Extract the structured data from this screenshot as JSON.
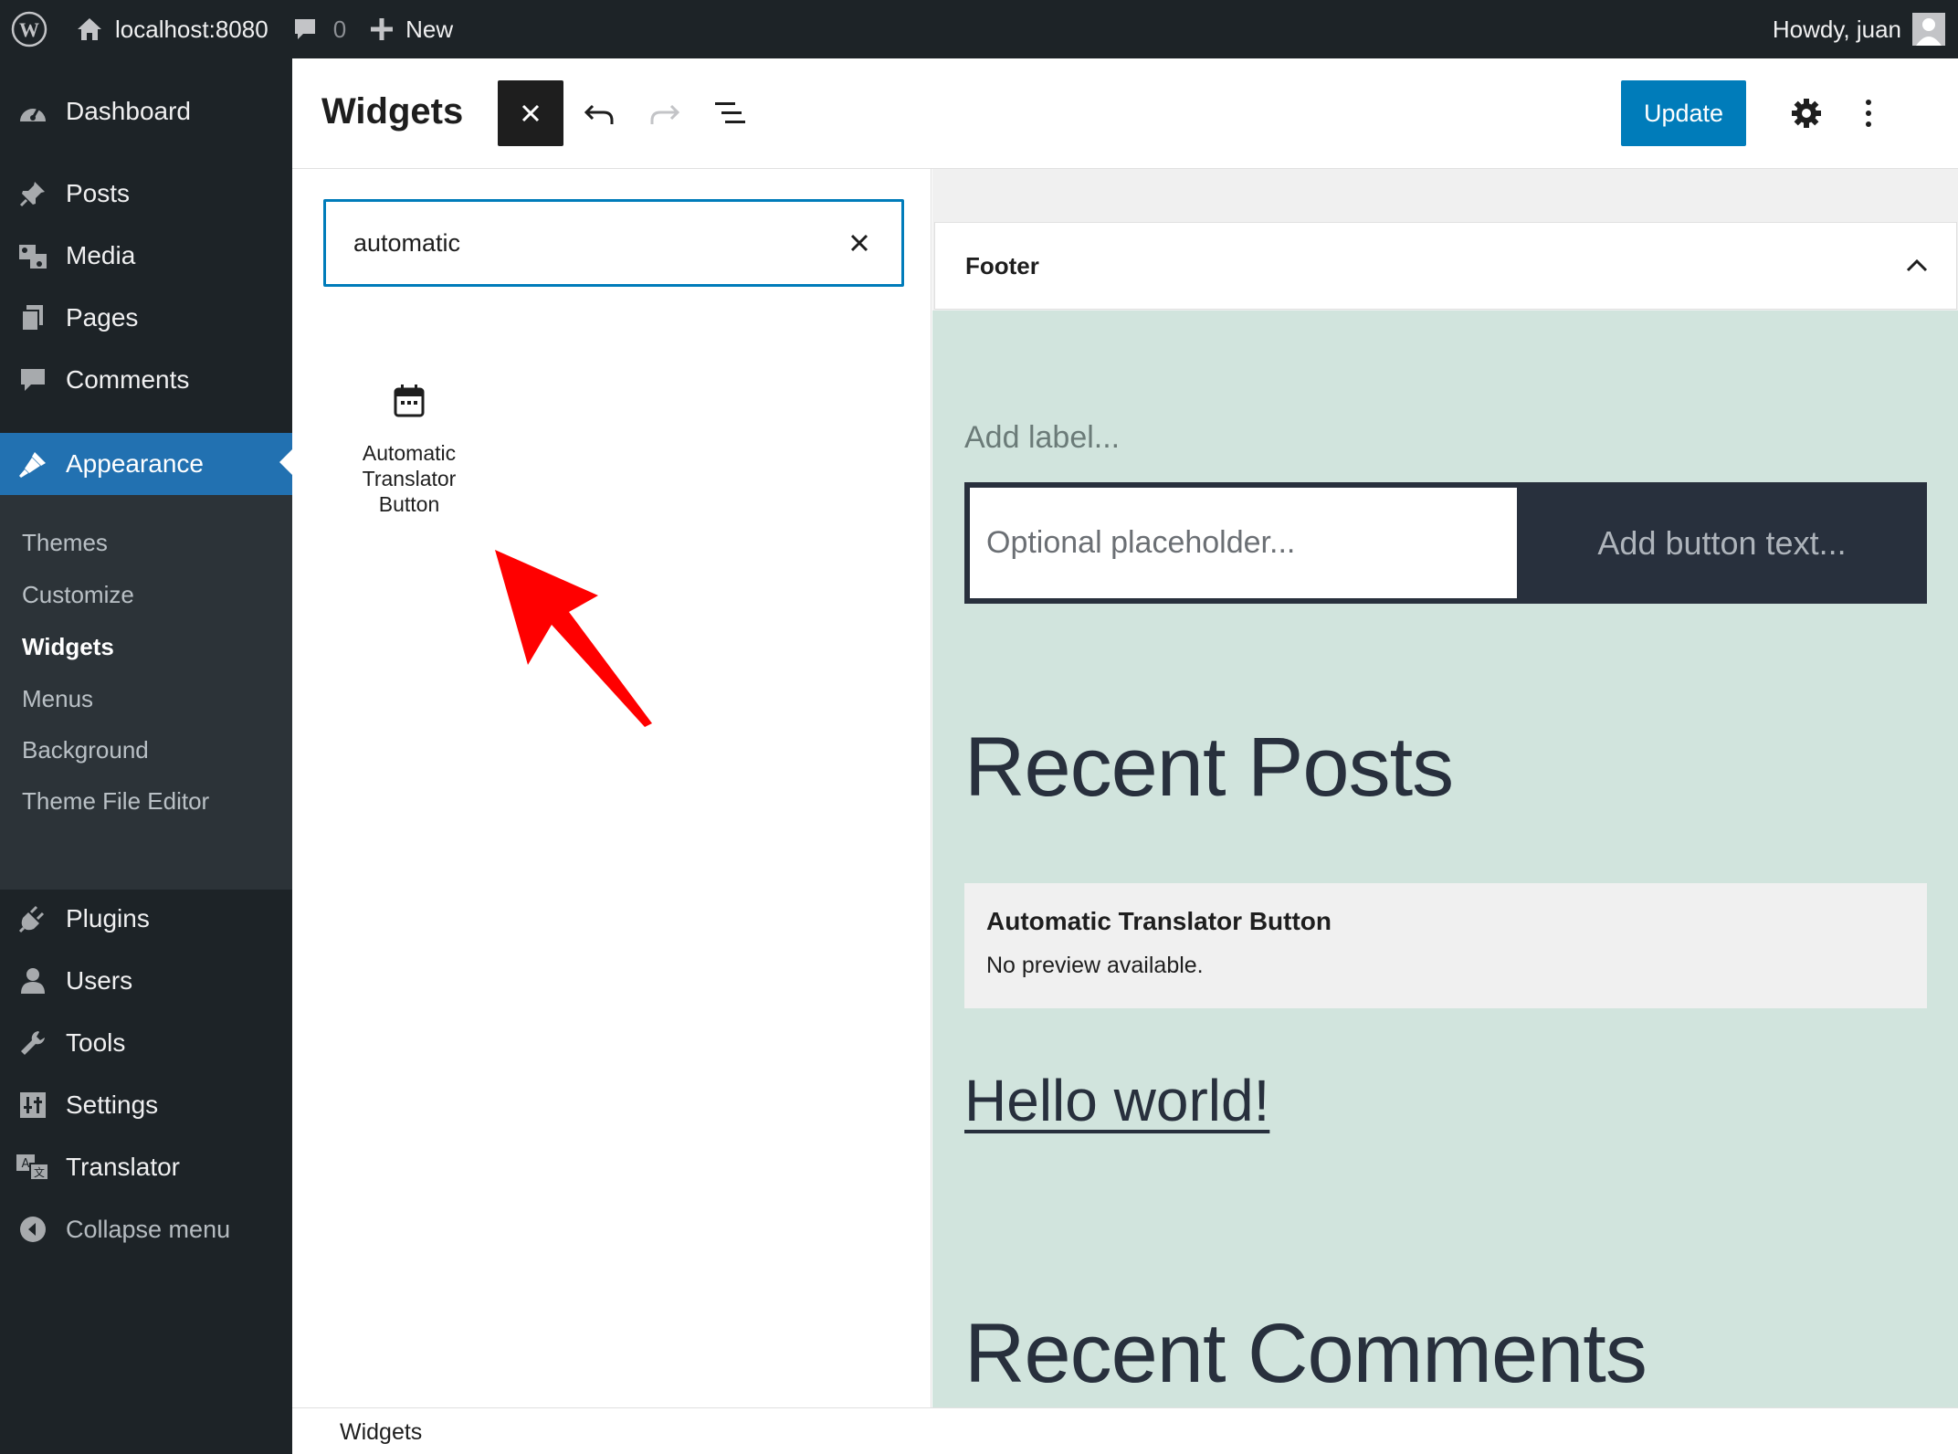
{
  "adminbar": {
    "site": "localhost:8080",
    "comments_count": "0",
    "new_label": "New",
    "greeting": "Howdy, juan"
  },
  "sidebar": {
    "items": [
      {
        "label": "Dashboard",
        "icon": "dashboard-icon"
      },
      {
        "label": "Posts",
        "icon": "pin-icon"
      },
      {
        "label": "Media",
        "icon": "media-icon"
      },
      {
        "label": "Pages",
        "icon": "pages-icon"
      },
      {
        "label": "Comments",
        "icon": "comment-icon"
      },
      {
        "label": "Appearance",
        "icon": "brush-icon"
      },
      {
        "label": "Plugins",
        "icon": "plugin-icon"
      },
      {
        "label": "Users",
        "icon": "user-icon"
      },
      {
        "label": "Tools",
        "icon": "wrench-icon"
      },
      {
        "label": "Settings",
        "icon": "settings-sliders-icon"
      },
      {
        "label": "Translator",
        "icon": "translate-icon"
      }
    ],
    "submenu": [
      "Themes",
      "Customize",
      "Widgets",
      "Menus",
      "Background",
      "Theme File Editor"
    ],
    "collapse_label": "Collapse menu",
    "accent": "#2271b1"
  },
  "header": {
    "title": "Widgets",
    "update_label": "Update",
    "update_color": "#007cba"
  },
  "inserter": {
    "search_value": "automatic",
    "result_label": "Automatic Translator Button"
  },
  "canvas": {
    "area_title": "Footer",
    "add_label": "Add label...",
    "search_placeholder": "Optional placeholder...",
    "search_button": "Add button text...",
    "recent_posts_heading": "Recent Posts",
    "legacy_widget_title": "Automatic Translator Button",
    "legacy_widget_text": "No preview available.",
    "post_link": "Hello world!",
    "recent_comments_heading": "Recent Comments",
    "background": "#d1e4dd"
  },
  "footer": {
    "breadcrumb": "Widgets"
  },
  "annotation": {
    "arrow_color": "#ff0000"
  }
}
